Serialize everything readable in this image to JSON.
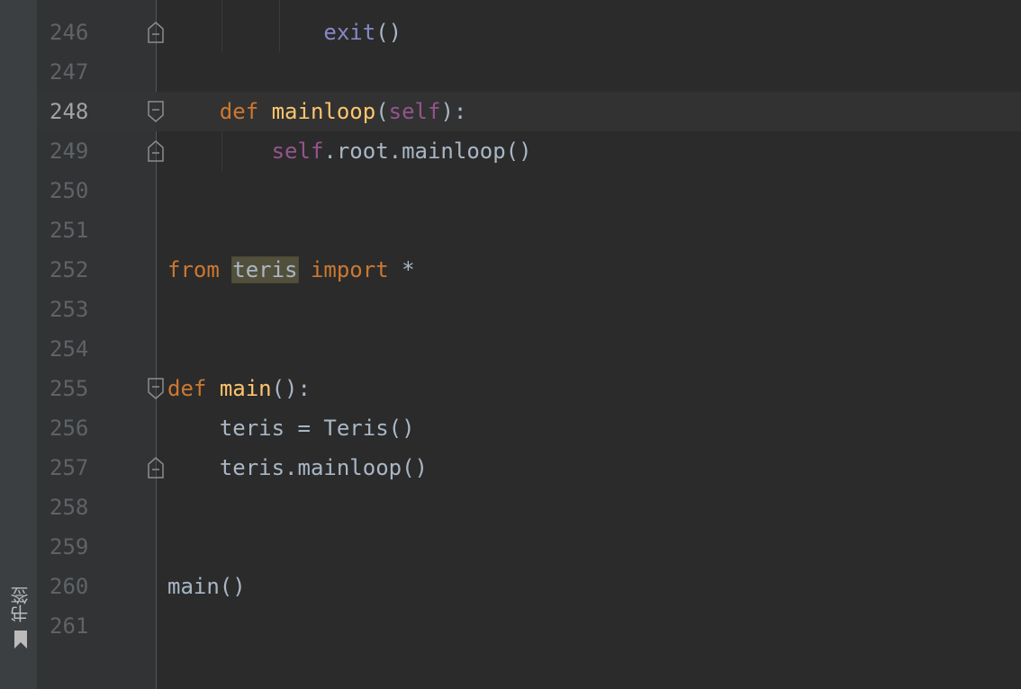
{
  "sidebar": {
    "bookmarks_label": "书签"
  },
  "editor": {
    "current_line": 248,
    "lines": [
      {
        "number": "246",
        "tokens": [
          {
            "text": "            ",
            "cls": ""
          },
          {
            "text": "exit",
            "cls": "bi"
          },
          {
            "text": "()",
            "cls": ""
          }
        ]
      },
      {
        "number": "247",
        "tokens": []
      },
      {
        "number": "248",
        "tokens": [
          {
            "text": "    ",
            "cls": ""
          },
          {
            "text": "def",
            "cls": "kw"
          },
          {
            "text": " ",
            "cls": ""
          },
          {
            "text": "mainloop",
            "cls": "fn"
          },
          {
            "text": "(",
            "cls": ""
          },
          {
            "text": "self",
            "cls": "self"
          },
          {
            "text": "):",
            "cls": ""
          }
        ]
      },
      {
        "number": "249",
        "tokens": [
          {
            "text": "        ",
            "cls": ""
          },
          {
            "text": "self",
            "cls": "self"
          },
          {
            "text": ".root.mainloop()",
            "cls": ""
          }
        ]
      },
      {
        "number": "250",
        "tokens": []
      },
      {
        "number": "251",
        "tokens": []
      },
      {
        "number": "252",
        "tokens": [
          {
            "text": "from",
            "cls": "kw"
          },
          {
            "text": " ",
            "cls": ""
          },
          {
            "text": "teris",
            "cls": "hl"
          },
          {
            "text": " ",
            "cls": ""
          },
          {
            "text": "import",
            "cls": "kw"
          },
          {
            "text": " *",
            "cls": ""
          }
        ]
      },
      {
        "number": "253",
        "tokens": []
      },
      {
        "number": "254",
        "tokens": []
      },
      {
        "number": "255",
        "tokens": [
          {
            "text": "def",
            "cls": "kw"
          },
          {
            "text": " ",
            "cls": ""
          },
          {
            "text": "main",
            "cls": "fn"
          },
          {
            "text": "():",
            "cls": ""
          }
        ]
      },
      {
        "number": "256",
        "tokens": [
          {
            "text": "    teris = Teris()",
            "cls": ""
          }
        ]
      },
      {
        "number": "257",
        "tokens": [
          {
            "text": "    teris.mainloop()",
            "cls": ""
          }
        ]
      },
      {
        "number": "258",
        "tokens": []
      },
      {
        "number": "259",
        "tokens": []
      },
      {
        "number": "260",
        "tokens": [
          {
            "text": "main()",
            "cls": ""
          }
        ]
      },
      {
        "number": "261",
        "tokens": []
      }
    ],
    "fold_markers": [
      {
        "line": "246",
        "kind": "fold-end"
      },
      {
        "line": "248",
        "kind": "fold-start"
      },
      {
        "line": "249",
        "kind": "fold-end"
      },
      {
        "line": "255",
        "kind": "fold-start"
      },
      {
        "line": "257",
        "kind": "fold-end"
      }
    ]
  }
}
